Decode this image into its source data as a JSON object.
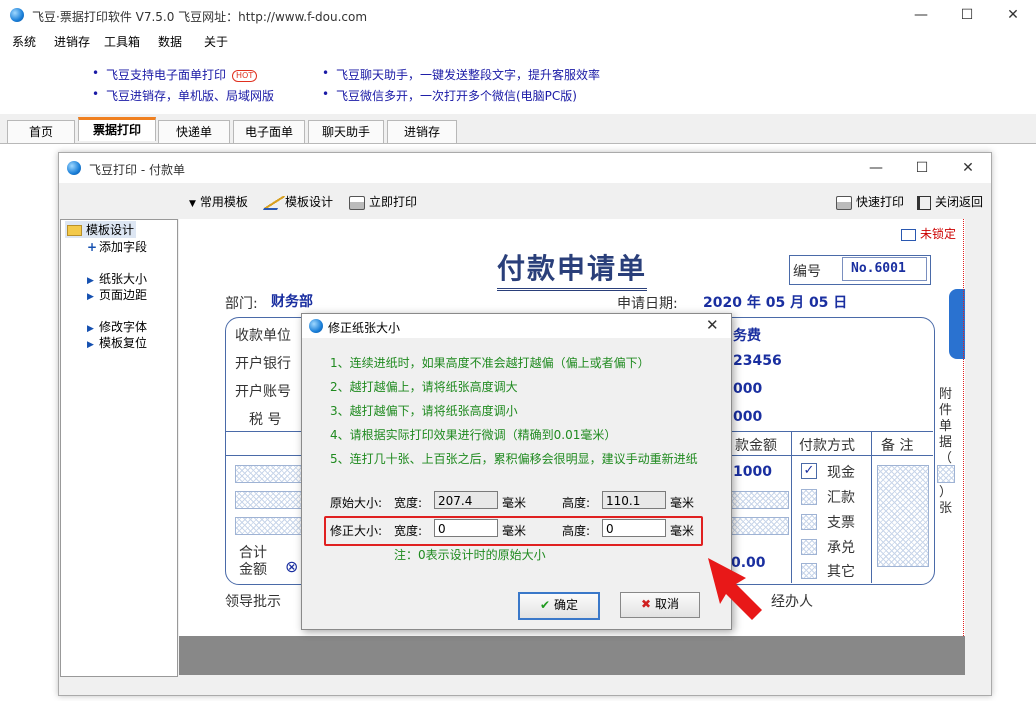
{
  "app": {
    "title": "飞豆·票据打印软件 V7.5.0   飞豆网址：http://www.f-dou.com",
    "window_controls": [
      "—",
      "☐",
      "✕"
    ]
  },
  "menu": [
    "系统",
    "进销存",
    "工具箱",
    "数据",
    "关于"
  ],
  "notices": {
    "left1": "飞豆支持电子面单打印",
    "left1_badge": "HOT",
    "left2": "飞豆进销存，单机版、局域网版",
    "right1": "飞豆聊天助手，一键发送整段文字，提升客服效率",
    "right2": "飞豆微信多开，一次打开多个微信(电脑PC版)"
  },
  "tabs": [
    "首页",
    "票据打印",
    "快递单",
    "电子面单",
    "聊天助手",
    "进销存"
  ],
  "active_tab": "票据打印",
  "inner_window": {
    "title": "飞豆打印 - 付款单",
    "toolbar": {
      "templates": "常用模板",
      "design": "模板设计",
      "print_now": "立即打印",
      "quick_print": "快速打印",
      "close_return": "关闭返回"
    },
    "tree": {
      "root": "模板设计",
      "add_field": "添加字段",
      "paper_size": "纸张大小",
      "page_margin": "页面边距",
      "modify_font": "修改字体",
      "template_reset": "模板复位"
    }
  },
  "form": {
    "unlocked": "未锁定",
    "title": "付款申请单",
    "number_label": "编号",
    "number_value": "No.6001",
    "dept_label": "部门:",
    "dept_value": "财务部",
    "date_label": "申请日期:",
    "date_value": "2020 年 05 月 05 日",
    "payee_label": "收款单位",
    "bank_label": "开户银行",
    "account_label": "开户账号",
    "tax_label": "税  号",
    "purpose_value": "务费",
    "bank_value": "23456",
    "account_value": "000",
    "tax_value": "000",
    "amount_header": "款金额",
    "amount_value": "1000",
    "pay_method_header": "付款方式",
    "remark_header": "备 注",
    "methods": [
      "现金",
      "汇款",
      "支票",
      "承兑",
      "其它"
    ],
    "total_label_1": "合计",
    "total_label_2": "金额",
    "total_value": "0.00",
    "leader_label": "领导批示",
    "handler_label": "经办人",
    "attachment_1": "附件单据（",
    "attachment_2": "）张"
  },
  "dialog": {
    "title": "修正纸张大小",
    "tips": [
      "1、连续进纸时，如果高度不准会越打越偏（偏上或者偏下）",
      "2、越打越偏上，请将纸张高度调大",
      "3、越打越偏下，请将纸张高度调小",
      "4、请根据实际打印效果进行微调（精确到0.01毫米）",
      "5、连打几十张、上百张之后，累积偏移会很明显，建议手动重新进纸"
    ],
    "orig_label": "原始大小:",
    "width_label": "宽度:",
    "height_label": "高度:",
    "unit": "毫米",
    "orig_width": "207.4",
    "orig_height": "110.1",
    "fix_label": "修正大小:",
    "fix_width": "0",
    "fix_height": "0",
    "note": "注：0表示设计时的原始大小",
    "ok": "确定",
    "cancel": "取消"
  }
}
